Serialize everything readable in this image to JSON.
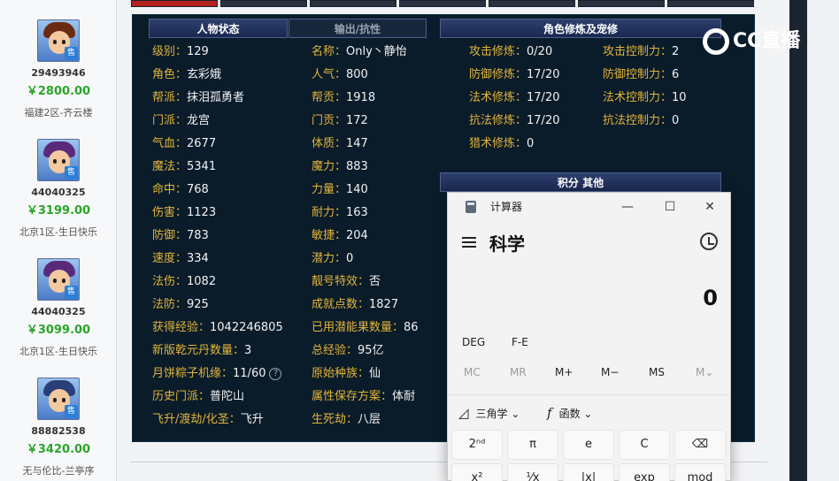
{
  "listings": [
    {
      "id": "29493946",
      "price": "￥2800.00",
      "server": "福建2区-齐云楼",
      "sale_badge": "售",
      "hair": "#6b2a12"
    },
    {
      "id": "44040325",
      "price": "￥3199.00",
      "server": "北京1区-生日快乐",
      "sale_badge": "售",
      "hair": "#5a2a7a"
    },
    {
      "id": "44040325",
      "price": "￥3099.00",
      "server": "北京1区-生日快乐",
      "sale_badge": "售",
      "hair": "#5a2a7a"
    },
    {
      "id": "88882538",
      "price": "￥3420.00",
      "server": "无与伦比-兰亭序",
      "sale_badge": "售",
      "hair": "#2a3f7a"
    }
  ],
  "panel": {
    "tab_status": "人物状态",
    "tab_resist": "输出/抗性",
    "tab_cultivation": "角色修炼及宠修",
    "tab_points": "积分 其他"
  },
  "stats_left": [
    {
      "k": "级别：",
      "v": "129"
    },
    {
      "k": "角色：",
      "v": "玄彩娥"
    },
    {
      "k": "帮派：",
      "v": "抹泪孤勇者"
    },
    {
      "k": "门派：",
      "v": "龙宫"
    },
    {
      "k": "气血：",
      "v": "2677"
    },
    {
      "k": "魔法：",
      "v": "5341"
    },
    {
      "k": "命中：",
      "v": "768"
    },
    {
      "k": "伤害：",
      "v": "1123"
    },
    {
      "k": "防御：",
      "v": "783"
    },
    {
      "k": "速度：",
      "v": "334"
    },
    {
      "k": "法伤：",
      "v": "1082"
    },
    {
      "k": "法防：",
      "v": "925"
    },
    {
      "k": "获得经验：",
      "v": "1042246805"
    },
    {
      "k": "新版乾元丹数量：",
      "v": "3"
    },
    {
      "k": "月饼粽子机缘：",
      "v": "11/60"
    },
    {
      "k": "历史门派：",
      "v": "普陀山"
    },
    {
      "k": "飞升/渡劫/化圣：",
      "v": "飞升"
    }
  ],
  "stats_mid": [
    {
      "k": "名称：",
      "v": "Only丶静怡"
    },
    {
      "k": "人气：",
      "v": "800"
    },
    {
      "k": "帮贡：",
      "v": "1918"
    },
    {
      "k": "门贡：",
      "v": "172"
    },
    {
      "k": "体质：",
      "v": "147"
    },
    {
      "k": "魔力：",
      "v": "883"
    },
    {
      "k": "力量：",
      "v": "140"
    },
    {
      "k": "耐力：",
      "v": "163"
    },
    {
      "k": "敏捷：",
      "v": "204"
    },
    {
      "k": "潜力：",
      "v": "0"
    },
    {
      "k": "靓号特效：",
      "v": "否"
    },
    {
      "k": "成就点数：",
      "v": "1827"
    },
    {
      "k": "已用潜能果数量：",
      "v": "86"
    },
    {
      "k": "总经验：",
      "v": "95亿"
    },
    {
      "k": "原始种族：",
      "v": "仙"
    },
    {
      "k": "属性保存方案：",
      "v": "体耐"
    },
    {
      "k": "生死劫：",
      "v": "八层"
    }
  ],
  "cultivation": [
    {
      "k": "攻击修炼：",
      "v": "0/20"
    },
    {
      "k": "防御修炼：",
      "v": "17/20"
    },
    {
      "k": "法术修炼：",
      "v": "17/20"
    },
    {
      "k": "抗法修炼：",
      "v": "17/20"
    },
    {
      "k": "猎术修炼：",
      "v": "0"
    }
  ],
  "control": [
    {
      "k": "攻击控制力：",
      "v": "2"
    },
    {
      "k": "防御控制力：",
      "v": "6"
    },
    {
      "k": "法术控制力：",
      "v": "10"
    },
    {
      "k": "抗法控制力：",
      "v": "0"
    }
  ],
  "help_glyph": "?",
  "logo": {
    "text": "CC直播"
  },
  "calculator": {
    "title": "计算器",
    "mode": "科学",
    "display": "0",
    "minimize": "—",
    "maximize": "☐",
    "close": "✕",
    "angle_unit": "DEG",
    "notation": "F-E",
    "memory": [
      "MC",
      "MR",
      "M+",
      "M−",
      "MS",
      "M⌄"
    ],
    "trig_label": "三角学",
    "func_label": "函数",
    "keys_row1": [
      "2ⁿᵈ",
      "π",
      "e",
      "C",
      "⌫"
    ],
    "keys_row2": [
      "x²",
      "¹⁄x",
      "|x|",
      "exp",
      "mod"
    ]
  }
}
